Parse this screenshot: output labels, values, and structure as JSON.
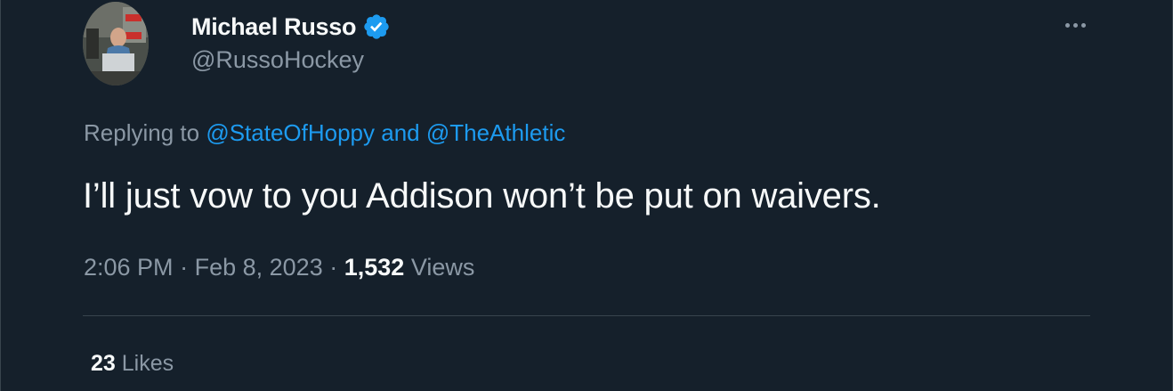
{
  "author": {
    "display_name": "Michael Russo",
    "handle": "@RussoHockey",
    "verified": true,
    "verified_color": "#1d9bf0"
  },
  "reply": {
    "prefix": "Replying to",
    "mention_1": "@StateOfHoppy",
    "joiner": "and",
    "mention_2": "@TheAthletic"
  },
  "tweet": {
    "text": "I’ll just vow to you Addison won’t be put on waivers."
  },
  "meta": {
    "time": "2:06 PM",
    "separator": "·",
    "date": "Feb 8, 2023",
    "views_count": "1,532",
    "views_label": "Views"
  },
  "engagement": {
    "likes_count": "23",
    "likes_label": "Likes"
  },
  "icons": {
    "more": "more-horizontal-icon",
    "verified": "verified-badge-icon"
  },
  "colors": {
    "background": "#15202b",
    "text_primary": "#f7f9f9",
    "text_secondary": "#8b98a5",
    "link": "#1d9bf0",
    "divider": "#38444d"
  }
}
